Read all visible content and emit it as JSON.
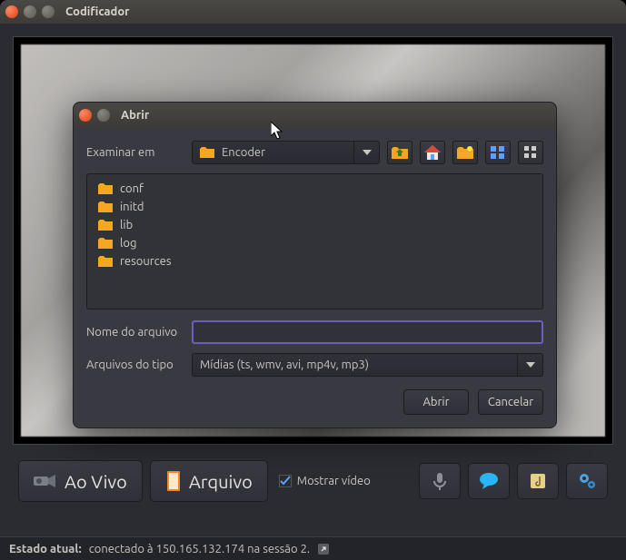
{
  "window": {
    "title": "Codificador"
  },
  "dialog": {
    "title": "Abrir",
    "examine_label": "Examinar em",
    "current_folder": "Encoder",
    "files": [
      "conf",
      "initd",
      "lib",
      "log",
      "resources"
    ],
    "filename_label": "Nome do arquivo",
    "filename_value": "",
    "filetype_label": "Arquivos do tipo",
    "filetype_value": "Mídias (ts, wmv, avi, mp4v, mp3)",
    "open_label": "Abrir",
    "cancel_label": "Cancelar"
  },
  "toolbar": {
    "live_label": "Ao Vivo",
    "file_label": "Arquivo",
    "show_video_label": "Mostrar vídeo"
  },
  "status": {
    "label": "Estado atual:",
    "text": "conectado à 150.165.132.174 na sessão 2."
  },
  "colors": {
    "accent": "#6a5fbf",
    "folder": "#f5a623"
  }
}
